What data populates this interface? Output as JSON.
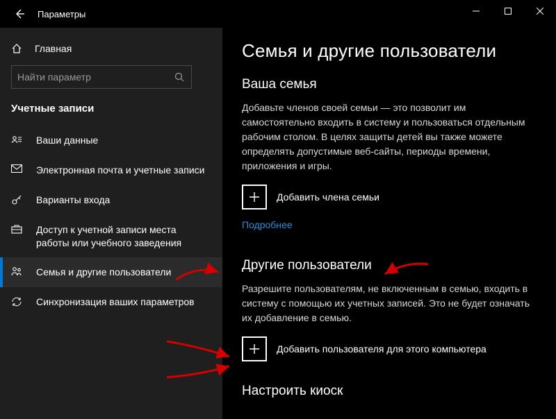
{
  "window": {
    "title": "Параметры"
  },
  "sidebar": {
    "home": "Главная",
    "search_placeholder": "Найти параметр",
    "section": "Учетные записи",
    "items": [
      {
        "label": "Ваши данные"
      },
      {
        "label": "Электронная почта и учетные записи"
      },
      {
        "label": "Варианты входа"
      },
      {
        "label": "Доступ к учетной записи места работы или учебного заведения"
      },
      {
        "label": "Семья и другие пользователи"
      },
      {
        "label": "Синхронизация ваших параметров"
      }
    ]
  },
  "main": {
    "title": "Семья и другие пользователи",
    "family_head": "Ваша семья",
    "family_body": "Добавьте членов своей семьи — это позволит им самостоятельно входить в систему и пользоваться отдельным рабочим столом. В целях защиты детей вы также можете определять допустимые веб-сайты, периоды времени, приложения и игры.",
    "add_family": "Добавить члена семьи",
    "learn_more": "Подробнее",
    "others_head": "Другие пользователи",
    "others_body": "Разрешите пользователям, не включенным в семью, входить в систему с помощью их учетных записей. Это не будет означать их добавление в семью.",
    "add_other": "Добавить пользователя для этого компьютера",
    "kiosk_head": "Настроить киоск"
  }
}
